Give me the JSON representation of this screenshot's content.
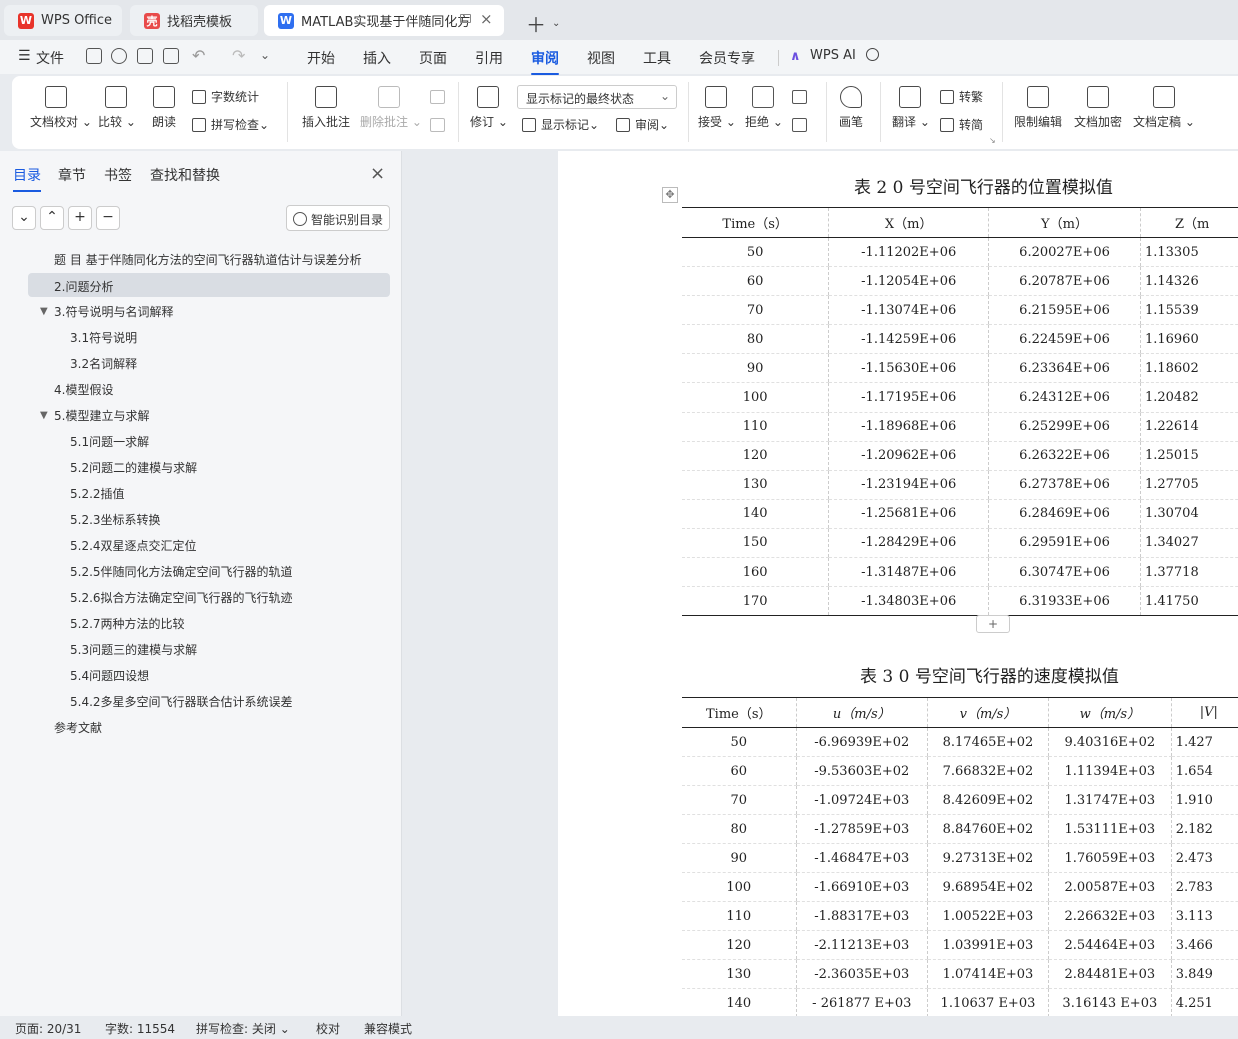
{
  "tabs": [
    {
      "label": "WPS Office",
      "icon": "wps-logo-icon",
      "color": "#e8332a"
    },
    {
      "label": "找稻壳模板",
      "icon": "daoke-logo-icon",
      "color": "#e84a4a"
    },
    {
      "label": "MATLAB实现基于伴随同化方",
      "icon": "word-doc-icon",
      "color": "#2f6ff0"
    }
  ],
  "menu": {
    "file": "文件",
    "items": [
      "开始",
      "插入",
      "页面",
      "引用",
      "审阅",
      "视图",
      "工具",
      "会员专享"
    ],
    "active": "审阅",
    "ai": "WPS AI"
  },
  "ribbon": {
    "doc_proof": "文档校对",
    "compare": "比较",
    "read_aloud": "朗读",
    "word_count": "字数统计",
    "spell_check": "拼写检查",
    "insert_comment": "插入批注",
    "delete_comment": "删除批注",
    "track_changes": "修订",
    "markup_state": "显示标记的最终状态",
    "show_markup": "显示标记",
    "review": "审阅",
    "accept": "接受",
    "reject": "拒绝",
    "pen": "画笔",
    "translate": "翻译",
    "to_traditional": "转繁",
    "to_simplified": "转简",
    "restrict_edit": "限制编辑",
    "encrypt": "文档加密",
    "finalize": "文档定稿"
  },
  "sidebar": {
    "tabs": [
      "目录",
      "章节",
      "书签",
      "查找和替换"
    ],
    "active_tab": "目录",
    "smart_toc": "智能识别目录",
    "toc": [
      {
        "text": "题 目 基于伴随同化方法的空间飞行器轨道估计与误差分析",
        "level": 0
      },
      {
        "text": "2.问题分析",
        "level": 0,
        "selected": true
      },
      {
        "text": "3.符号说明与名词解释",
        "level": 0,
        "expanded": true
      },
      {
        "text": "3.1符号说明",
        "level": 1
      },
      {
        "text": "3.2名词解释",
        "level": 1
      },
      {
        "text": "4.模型假设",
        "level": 0
      },
      {
        "text": "5.模型建立与求解",
        "level": 0,
        "expanded": true
      },
      {
        "text": "5.1问题一求解",
        "level": 1
      },
      {
        "text": "5.2问题二的建模与求解",
        "level": 1
      },
      {
        "text": "5.2.2插值",
        "level": 1
      },
      {
        "text": "5.2.3坐标系转换",
        "level": 1
      },
      {
        "text": "5.2.4双星逐点交汇定位",
        "level": 1
      },
      {
        "text": "5.2.5伴随同化方法确定空间飞行器的轨道",
        "level": 1
      },
      {
        "text": "5.2.6拟合方法确定空间飞行器的飞行轨迹",
        "level": 1
      },
      {
        "text": "5.2.7两种方法的比较",
        "level": 1
      },
      {
        "text": "5.3问题三的建模与求解",
        "level": 1
      },
      {
        "text": "5.4问题四设想",
        "level": 1
      },
      {
        "text": "5.4.2多星多空间飞行器联合估计系统误差",
        "level": 1
      },
      {
        "text": "参考文献",
        "level": 0
      }
    ]
  },
  "document": {
    "table2": {
      "caption": "表 2    0 号空间飞行器的位置模拟值",
      "headers": [
        "Time（s）",
        "X（m）",
        "Y（m）",
        "Z（m"
      ],
      "rows": [
        [
          "50",
          "-1.11202E+06",
          "6.20027E+06",
          "1.13305"
        ],
        [
          "60",
          "-1.12054E+06",
          "6.20787E+06",
          "1.14326"
        ],
        [
          "70",
          "-1.13074E+06",
          "6.21595E+06",
          "1.15539"
        ],
        [
          "80",
          "-1.14259E+06",
          "6.22459E+06",
          "1.16960"
        ],
        [
          "90",
          "-1.15630E+06",
          "6.23364E+06",
          "1.18602"
        ],
        [
          "100",
          "-1.17195E+06",
          "6.24312E+06",
          "1.20482"
        ],
        [
          "110",
          "-1.18968E+06",
          "6.25299E+06",
          "1.22614"
        ],
        [
          "120",
          "-1.20962E+06",
          "6.26322E+06",
          "1.25015"
        ],
        [
          "130",
          "-1.23194E+06",
          "6.27378E+06",
          "1.27705"
        ],
        [
          "140",
          "-1.25681E+06",
          "6.28469E+06",
          "1.30704"
        ],
        [
          "150",
          "-1.28429E+06",
          "6.29591E+06",
          "1.34027"
        ],
        [
          "160",
          "-1.31487E+06",
          "6.30747E+06",
          "1.37718"
        ],
        [
          "170",
          "-1.34803E+06",
          "6.31933E+06",
          "1.41750"
        ]
      ]
    },
    "table3": {
      "caption": "表 3    0 号空间飞行器的速度模拟值",
      "headers": [
        "Time（s）",
        "u（m/s）",
        "v（m/s）",
        "w（m/s）",
        "|V|"
      ],
      "rows": [
        [
          "50",
          "-6.96939E+02",
          "8.17465E+02",
          "9.40316E+02",
          "1.427"
        ],
        [
          "60",
          "-9.53603E+02",
          "7.66832E+02",
          "1.11394E+03",
          "1.654"
        ],
        [
          "70",
          "-1.09724E+03",
          "8.42609E+02",
          "1.31747E+03",
          "1.910"
        ],
        [
          "80",
          "-1.27859E+03",
          "8.84760E+02",
          "1.53111E+03",
          "2.182"
        ],
        [
          "90",
          "-1.46847E+03",
          "9.27313E+02",
          "1.76059E+03",
          "2.473"
        ],
        [
          "100",
          "-1.66910E+03",
          "9.68954E+02",
          "2.00587E+03",
          "2.783"
        ],
        [
          "110",
          "-1.88317E+03",
          "1.00522E+03",
          "2.26632E+03",
          "3.113"
        ],
        [
          "120",
          "-2.11213E+03",
          "1.03991E+03",
          "2.54464E+03",
          "3.466"
        ],
        [
          "130",
          "-2.36035E+03",
          "1.07414E+03",
          "2.84481E+03",
          "3.849"
        ],
        [
          "140",
          "- 261877 E+03",
          "1.10637 E+03",
          "3.16143 E+03",
          "4.251"
        ]
      ]
    }
  },
  "status": {
    "page": "页面: 20/31",
    "words": "字数: 11554",
    "spell": "拼写检查: 关闭",
    "proof": "校对",
    "compat": "兼容模式"
  }
}
